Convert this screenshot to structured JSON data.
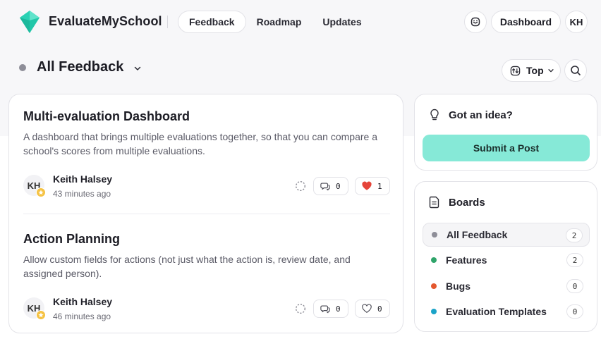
{
  "header": {
    "brand": "EvaluateMySchool",
    "nav": [
      {
        "label": "Feedback",
        "active": true
      },
      {
        "label": "Roadmap",
        "active": false
      },
      {
        "label": "Updates",
        "active": false
      }
    ],
    "dashboard_label": "Dashboard",
    "user_initials": "KH"
  },
  "toolbar": {
    "board_title": "All Feedback",
    "sort_label": "Top"
  },
  "posts": [
    {
      "title": "Multi-evaluation Dashboard",
      "description": "A dashboard that brings multiple evaluations together, so that you can compare a school's scores from multiple evaluations.",
      "author": "Keith Halsey",
      "author_initials": "KH",
      "time": "43 minutes ago",
      "comments": "0",
      "likes": "1",
      "liked": true
    },
    {
      "title": "Action Planning",
      "description": "Allow custom fields for actions (not just what the action is, review date, and assigned person).",
      "author": "Keith Halsey",
      "author_initials": "KH",
      "time": "46 minutes ago",
      "comments": "0",
      "likes": "0",
      "liked": false
    }
  ],
  "idea": {
    "title": "Got an idea?",
    "button": "Submit a Post"
  },
  "boards": {
    "title": "Boards",
    "items": [
      {
        "label": "All Feedback",
        "count": "2",
        "color": "#8e8e98",
        "active": true
      },
      {
        "label": "Features",
        "count": "2",
        "color": "#2fa46a",
        "active": false
      },
      {
        "label": "Bugs",
        "count": "0",
        "color": "#e4572e",
        "active": false
      },
      {
        "label": "Evaluation Templates",
        "count": "0",
        "color": "#1aa3c8",
        "active": false
      }
    ]
  },
  "colors": {
    "accent": "#86e9d7",
    "brand_logo": "#2ad1b4",
    "heart_active": "#e5453a"
  },
  "icons": [
    "logo-gem-icon",
    "support-icon",
    "chevron-down-icon",
    "sort-icon",
    "search-icon",
    "status-icon",
    "comment-icon",
    "heart-icon",
    "star-icon",
    "lightbulb-icon",
    "document-icon"
  ]
}
